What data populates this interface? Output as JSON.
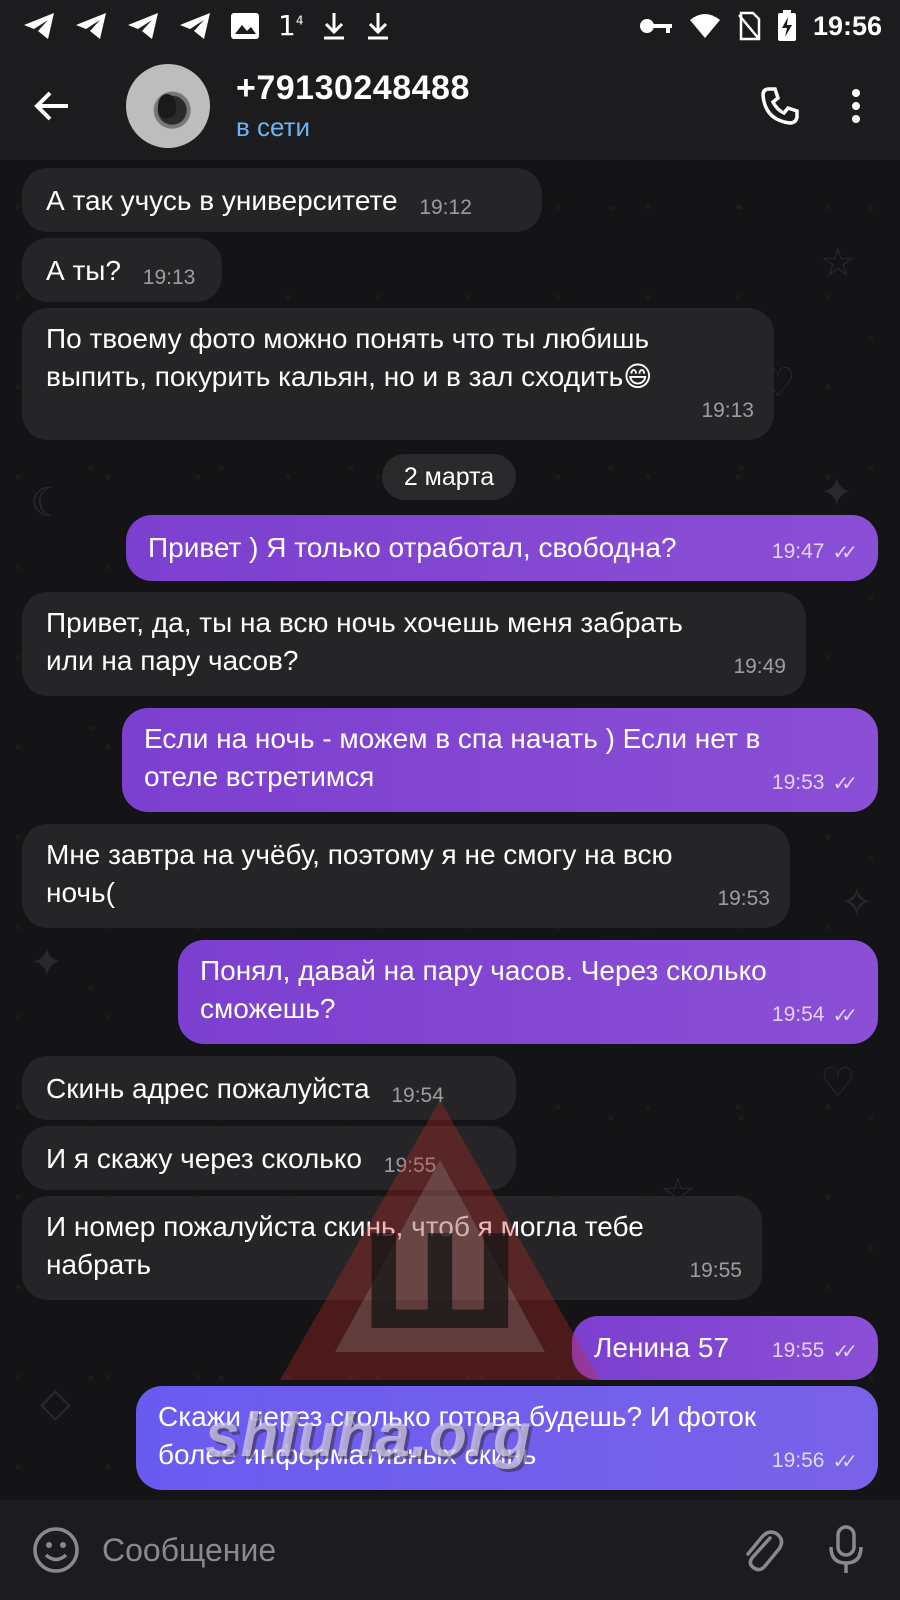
{
  "status_bar": {
    "time": "19:56",
    "left_icons": [
      "telegram-icon",
      "telegram-icon",
      "telegram-icon",
      "telegram-icon",
      "image-icon",
      "download-icon",
      "download-icon"
    ],
    "network_badge": "1",
    "right_icons": [
      "key-icon",
      "wifi-icon",
      "no-sim-icon",
      "battery-charging-icon"
    ]
  },
  "header": {
    "title": "+79130248488",
    "status": "в сети",
    "status_color": "#6fb3f0"
  },
  "messages": [
    {
      "dir": "in",
      "text": "А так учусь в университете",
      "time": "19:12"
    },
    {
      "dir": "in",
      "text": "А ты?",
      "time": "19:13"
    },
    {
      "dir": "in",
      "text_line1": "По твоему фото можно понять что ты любишь",
      "text_line2": "выпить, покурить кальян, но и в зал сходить😄",
      "time": "19:13"
    },
    {
      "dir": "out",
      "text": "Привет ) Я только отработал, свободна?",
      "time": "19:47"
    },
    {
      "dir": "in",
      "text_line1": "Привет, да, ты на всю ночь хочешь меня забрать",
      "text_line2": "или на пару часов?",
      "time": "19:49"
    },
    {
      "dir": "out",
      "text_line1": "Если на ночь - можем в спа начать ) Если нет в",
      "text_line2": "отеле встретимся",
      "time": "19:53"
    },
    {
      "dir": "in",
      "text_line1": "Мне завтра на учёбу, поэтому я не смогу на всю",
      "text_line2": "ночь(",
      "time": "19:53"
    },
    {
      "dir": "out",
      "text_line1": "Понял, давай на пару часов. Через сколько",
      "text_line2": "сможешь?",
      "time": "19:54"
    },
    {
      "dir": "in",
      "text": "Скинь адрес пожалуйста",
      "time": "19:54"
    },
    {
      "dir": "in",
      "text": "И я скажу через сколько",
      "time": "19:55"
    },
    {
      "dir": "in",
      "text_line1": "И номер пожалуйста скинь, чтоб я могла тебе",
      "text_line2": "набрать",
      "time": "19:55"
    },
    {
      "dir": "out",
      "text": "Ленина 57",
      "time": "19:55"
    },
    {
      "dir": "out",
      "text_line1": "Скажи через сколько готова будешь? И фоток",
      "text_line2": "более информативных скинь",
      "time": "19:56"
    }
  ],
  "date_divider": "2 марта",
  "watermark": {
    "text": "shluha.org",
    "badge_letter": "Ш"
  },
  "composer": {
    "placeholder": "Сообщение"
  },
  "colors": {
    "incoming_bubble": "#252528",
    "outgoing_bubble": "#8b4fd6",
    "background": "#141416"
  }
}
